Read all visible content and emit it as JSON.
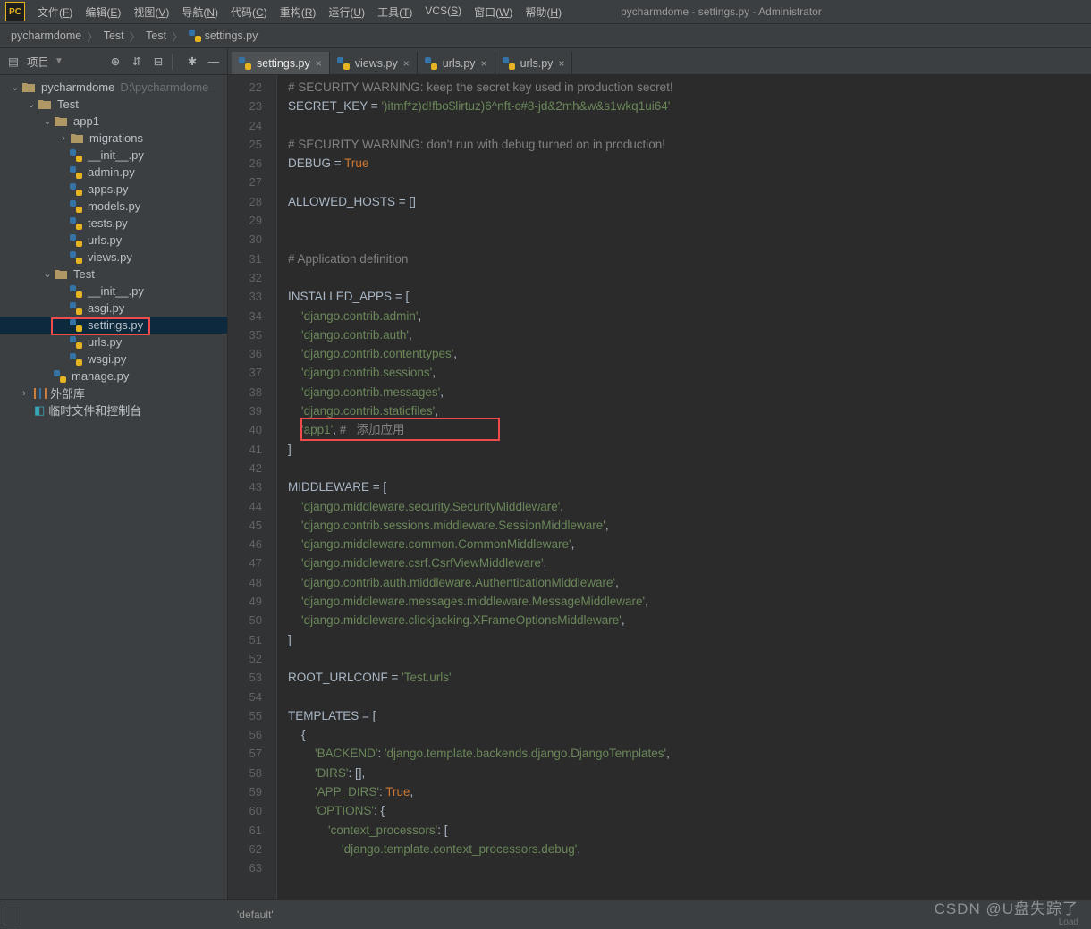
{
  "window": {
    "title": "pycharmdome - settings.py - Administrator"
  },
  "menu": [
    "文件(F)",
    "编辑(E)",
    "视图(V)",
    "导航(N)",
    "代码(C)",
    "重构(R)",
    "运行(U)",
    "工具(T)",
    "VCS(S)",
    "窗口(W)",
    "帮助(H)"
  ],
  "breadcrumb": [
    "pycharmdome",
    "Test",
    "Test",
    "settings.py"
  ],
  "sidebar": {
    "title": "项目",
    "root": {
      "name": "pycharmdome",
      "hint": "D:\\pycharmdome"
    },
    "tree": [
      {
        "d": 0,
        "tog": "v",
        "ico": "dir",
        "label": "pycharmdome",
        "hint": "D:\\pycharmdome"
      },
      {
        "d": 1,
        "tog": "v",
        "ico": "dir",
        "label": "Test"
      },
      {
        "d": 2,
        "tog": "v",
        "ico": "dir",
        "label": "app1"
      },
      {
        "d": 3,
        "tog": ">",
        "ico": "dir",
        "label": "migrations"
      },
      {
        "d": 3,
        "tog": "",
        "ico": "py",
        "label": "__init__.py"
      },
      {
        "d": 3,
        "tog": "",
        "ico": "py",
        "label": "admin.py"
      },
      {
        "d": 3,
        "tog": "",
        "ico": "py",
        "label": "apps.py"
      },
      {
        "d": 3,
        "tog": "",
        "ico": "py",
        "label": "models.py"
      },
      {
        "d": 3,
        "tog": "",
        "ico": "py",
        "label": "tests.py"
      },
      {
        "d": 3,
        "tog": "",
        "ico": "py",
        "label": "urls.py"
      },
      {
        "d": 3,
        "tog": "",
        "ico": "py",
        "label": "views.py"
      },
      {
        "d": 2,
        "tog": "v",
        "ico": "dir",
        "label": "Test"
      },
      {
        "d": 3,
        "tog": "",
        "ico": "py",
        "label": "__init__.py"
      },
      {
        "d": 3,
        "tog": "",
        "ico": "py",
        "label": "asgi.py"
      },
      {
        "d": 3,
        "tog": "",
        "ico": "py",
        "label": "settings.py",
        "sel": true
      },
      {
        "d": 3,
        "tog": "",
        "ico": "py",
        "label": "urls.py"
      },
      {
        "d": 3,
        "tog": "",
        "ico": "py",
        "label": "wsgi.py"
      },
      {
        "d": 2,
        "tog": "",
        "ico": "py",
        "label": "manage.py"
      }
    ],
    "ext_lib": "外部库",
    "scratches": "临时文件和控制台"
  },
  "tabs": [
    {
      "label": "settings.py",
      "active": true
    },
    {
      "label": "views.py"
    },
    {
      "label": "urls.py"
    },
    {
      "label": "urls.py"
    }
  ],
  "gutter_start": 22,
  "code_lines": [
    [
      {
        "t": "# SECURITY WARNING: keep the secret key used in production secret!",
        "c": "cmt"
      }
    ],
    [
      {
        "t": "SECRET_KEY ",
        "c": "id"
      },
      {
        "t": "= ",
        "c": "id"
      },
      {
        "t": "')itmf*z)d!fbo$lirtuz)6^nft-c#8-jd&2mh&w&s1wkq1ui64'",
        "c": "str"
      }
    ],
    [],
    [
      {
        "t": "# SECURITY WARNING: don't run with debug turned on in production!",
        "c": "cmt"
      }
    ],
    [
      {
        "t": "DEBUG ",
        "c": "id"
      },
      {
        "t": "= ",
        "c": "id"
      },
      {
        "t": "True",
        "c": "kw"
      }
    ],
    [],
    [
      {
        "t": "ALLOWED_HOSTS ",
        "c": "id"
      },
      {
        "t": "= []",
        "c": "id"
      }
    ],
    [],
    [],
    [
      {
        "t": "# Application definition",
        "c": "cmt"
      }
    ],
    [],
    [
      {
        "t": "INSTALLED_APPS ",
        "c": "id"
      },
      {
        "t": "= [",
        "c": "id"
      }
    ],
    [
      {
        "t": "    ",
        "c": "id"
      },
      {
        "t": "'django.contrib.admin'",
        "c": "str"
      },
      {
        "t": ",",
        "c": "id"
      }
    ],
    [
      {
        "t": "    ",
        "c": "id"
      },
      {
        "t": "'django.contrib.auth'",
        "c": "str"
      },
      {
        "t": ",",
        "c": "id"
      }
    ],
    [
      {
        "t": "    ",
        "c": "id"
      },
      {
        "t": "'django.contrib.contenttypes'",
        "c": "str"
      },
      {
        "t": ",",
        "c": "id"
      }
    ],
    [
      {
        "t": "    ",
        "c": "id"
      },
      {
        "t": "'django.contrib.sessions'",
        "c": "str"
      },
      {
        "t": ",",
        "c": "id"
      }
    ],
    [
      {
        "t": "    ",
        "c": "id"
      },
      {
        "t": "'django.contrib.messages'",
        "c": "str"
      },
      {
        "t": ",",
        "c": "id"
      }
    ],
    [
      {
        "t": "    ",
        "c": "id"
      },
      {
        "t": "'django.contrib.staticfiles'",
        "c": "str"
      },
      {
        "t": ",",
        "c": "id"
      }
    ],
    [
      {
        "t": "    ",
        "c": "id"
      },
      {
        "t": "'app1'",
        "c": "str"
      },
      {
        "t": ", ",
        "c": "id"
      },
      {
        "t": "#   添加应用",
        "c": "cmt"
      }
    ],
    [
      {
        "t": "]",
        "c": "id"
      }
    ],
    [],
    [
      {
        "t": "MIDDLEWARE ",
        "c": "id"
      },
      {
        "t": "= [",
        "c": "id"
      }
    ],
    [
      {
        "t": "    ",
        "c": "id"
      },
      {
        "t": "'django.middleware.security.SecurityMiddleware'",
        "c": "str"
      },
      {
        "t": ",",
        "c": "id"
      }
    ],
    [
      {
        "t": "    ",
        "c": "id"
      },
      {
        "t": "'django.contrib.sessions.middleware.SessionMiddleware'",
        "c": "str"
      },
      {
        "t": ",",
        "c": "id"
      }
    ],
    [
      {
        "t": "    ",
        "c": "id"
      },
      {
        "t": "'django.middleware.common.CommonMiddleware'",
        "c": "str"
      },
      {
        "t": ",",
        "c": "id"
      }
    ],
    [
      {
        "t": "    ",
        "c": "id"
      },
      {
        "t": "'django.middleware.csrf.CsrfViewMiddleware'",
        "c": "str"
      },
      {
        "t": ",",
        "c": "id"
      }
    ],
    [
      {
        "t": "    ",
        "c": "id"
      },
      {
        "t": "'django.contrib.auth.middleware.AuthenticationMiddleware'",
        "c": "str"
      },
      {
        "t": ",",
        "c": "id"
      }
    ],
    [
      {
        "t": "    ",
        "c": "id"
      },
      {
        "t": "'django.middleware.messages.middleware.MessageMiddleware'",
        "c": "str"
      },
      {
        "t": ",",
        "c": "id"
      }
    ],
    [
      {
        "t": "    ",
        "c": "id"
      },
      {
        "t": "'django.middleware.clickjacking.XFrameOptionsMiddleware'",
        "c": "str"
      },
      {
        "t": ",",
        "c": "id"
      }
    ],
    [
      {
        "t": "]",
        "c": "id"
      }
    ],
    [],
    [
      {
        "t": "ROOT_URLCONF ",
        "c": "id"
      },
      {
        "t": "= ",
        "c": "id"
      },
      {
        "t": "'Test.urls'",
        "c": "str"
      }
    ],
    [],
    [
      {
        "t": "TEMPLATES ",
        "c": "id"
      },
      {
        "t": "= [",
        "c": "id"
      }
    ],
    [
      {
        "t": "    {",
        "c": "id"
      }
    ],
    [
      {
        "t": "        ",
        "c": "id"
      },
      {
        "t": "'BACKEND'",
        "c": "str"
      },
      {
        "t": ": ",
        "c": "id"
      },
      {
        "t": "'django.template.backends.django.DjangoTemplates'",
        "c": "str"
      },
      {
        "t": ",",
        "c": "id"
      }
    ],
    [
      {
        "t": "        ",
        "c": "id"
      },
      {
        "t": "'DIRS'",
        "c": "str"
      },
      {
        "t": ": [],",
        "c": "id"
      }
    ],
    [
      {
        "t": "        ",
        "c": "id"
      },
      {
        "t": "'APP_DIRS'",
        "c": "str"
      },
      {
        "t": ": ",
        "c": "id"
      },
      {
        "t": "True",
        "c": "kw"
      },
      {
        "t": ",",
        "c": "id"
      }
    ],
    [
      {
        "t": "        ",
        "c": "id"
      },
      {
        "t": "'OPTIONS'",
        "c": "str"
      },
      {
        "t": ": {",
        "c": "id"
      }
    ],
    [
      {
        "t": "            ",
        "c": "id"
      },
      {
        "t": "'context_processors'",
        "c": "str"
      },
      {
        "t": ": [",
        "c": "id"
      }
    ],
    [
      {
        "t": "                ",
        "c": "id"
      },
      {
        "t": "'django.template.context_processors.debug'",
        "c": "str"
      },
      {
        "t": ",",
        "c": "id"
      }
    ],
    []
  ],
  "status": {
    "text": "'default'"
  },
  "watermark": "CSDN @U盘失踪了",
  "load_hint": "Load"
}
